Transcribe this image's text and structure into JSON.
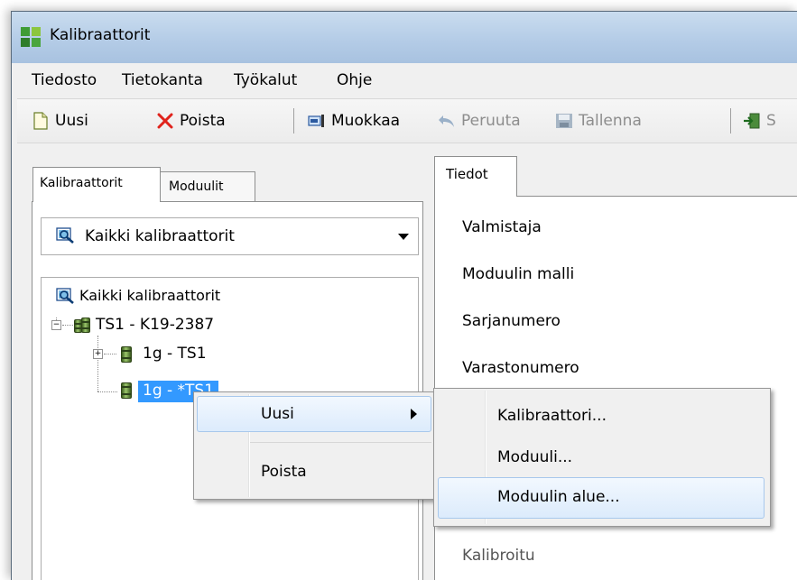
{
  "window": {
    "title": "Kalibraattorit"
  },
  "menu": [
    "Tiedosto",
    "Tietokanta",
    "Työkalut",
    "Ohje"
  ],
  "toolbar": {
    "new_label": "Uusi",
    "delete_label": "Poista",
    "edit_label": "Muokkaa",
    "cancel_label": "Peruuta",
    "save_label": "Tallenna",
    "partial_label": "S"
  },
  "left_tabs": [
    "Kalibraattorit",
    "Moduulit"
  ],
  "filter": {
    "selected": "Kaikki kalibraattorit"
  },
  "tree": {
    "root": "Kaikki kalibraattorit",
    "calibrator": "TS1 - K19-2387",
    "module1": "1g - TS1",
    "module2": "1g - *TS1"
  },
  "right_tab": "Tiedot",
  "fields": [
    "Valmistaja",
    "Moduulin malli",
    "Sarjanumero",
    "Varastonumero",
    "Kalibroitu"
  ],
  "context_menu": {
    "new_label": "Uusi",
    "delete_label": "Poista"
  },
  "submenu": [
    "Kalibraattori...",
    "Moduuli...",
    "Moduulin alue..."
  ],
  "colors": {
    "selection": "#3399ff",
    "titlebar": "#b9cfe8"
  }
}
